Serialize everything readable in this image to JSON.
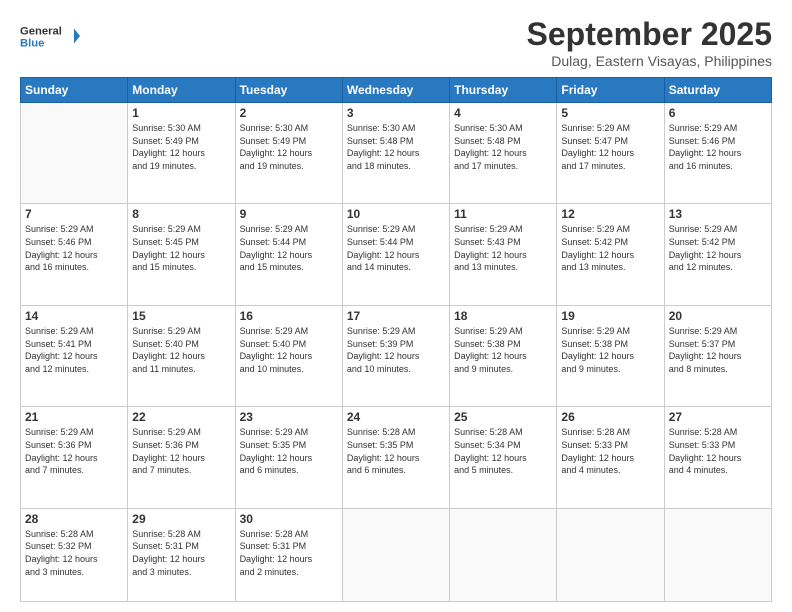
{
  "header": {
    "logo_line1": "General",
    "logo_line2": "Blue",
    "month": "September 2025",
    "location": "Dulag, Eastern Visayas, Philippines"
  },
  "weekdays": [
    "Sunday",
    "Monday",
    "Tuesday",
    "Wednesday",
    "Thursday",
    "Friday",
    "Saturday"
  ],
  "weeks": [
    [
      {
        "day": "",
        "info": ""
      },
      {
        "day": "1",
        "info": "Sunrise: 5:30 AM\nSunset: 5:49 PM\nDaylight: 12 hours\nand 19 minutes."
      },
      {
        "day": "2",
        "info": "Sunrise: 5:30 AM\nSunset: 5:49 PM\nDaylight: 12 hours\nand 19 minutes."
      },
      {
        "day": "3",
        "info": "Sunrise: 5:30 AM\nSunset: 5:48 PM\nDaylight: 12 hours\nand 18 minutes."
      },
      {
        "day": "4",
        "info": "Sunrise: 5:30 AM\nSunset: 5:48 PM\nDaylight: 12 hours\nand 17 minutes."
      },
      {
        "day": "5",
        "info": "Sunrise: 5:29 AM\nSunset: 5:47 PM\nDaylight: 12 hours\nand 17 minutes."
      },
      {
        "day": "6",
        "info": "Sunrise: 5:29 AM\nSunset: 5:46 PM\nDaylight: 12 hours\nand 16 minutes."
      }
    ],
    [
      {
        "day": "7",
        "info": "Sunrise: 5:29 AM\nSunset: 5:46 PM\nDaylight: 12 hours\nand 16 minutes."
      },
      {
        "day": "8",
        "info": "Sunrise: 5:29 AM\nSunset: 5:45 PM\nDaylight: 12 hours\nand 15 minutes."
      },
      {
        "day": "9",
        "info": "Sunrise: 5:29 AM\nSunset: 5:44 PM\nDaylight: 12 hours\nand 15 minutes."
      },
      {
        "day": "10",
        "info": "Sunrise: 5:29 AM\nSunset: 5:44 PM\nDaylight: 12 hours\nand 14 minutes."
      },
      {
        "day": "11",
        "info": "Sunrise: 5:29 AM\nSunset: 5:43 PM\nDaylight: 12 hours\nand 13 minutes."
      },
      {
        "day": "12",
        "info": "Sunrise: 5:29 AM\nSunset: 5:42 PM\nDaylight: 12 hours\nand 13 minutes."
      },
      {
        "day": "13",
        "info": "Sunrise: 5:29 AM\nSunset: 5:42 PM\nDaylight: 12 hours\nand 12 minutes."
      }
    ],
    [
      {
        "day": "14",
        "info": "Sunrise: 5:29 AM\nSunset: 5:41 PM\nDaylight: 12 hours\nand 12 minutes."
      },
      {
        "day": "15",
        "info": "Sunrise: 5:29 AM\nSunset: 5:40 PM\nDaylight: 12 hours\nand 11 minutes."
      },
      {
        "day": "16",
        "info": "Sunrise: 5:29 AM\nSunset: 5:40 PM\nDaylight: 12 hours\nand 10 minutes."
      },
      {
        "day": "17",
        "info": "Sunrise: 5:29 AM\nSunset: 5:39 PM\nDaylight: 12 hours\nand 10 minutes."
      },
      {
        "day": "18",
        "info": "Sunrise: 5:29 AM\nSunset: 5:38 PM\nDaylight: 12 hours\nand 9 minutes."
      },
      {
        "day": "19",
        "info": "Sunrise: 5:29 AM\nSunset: 5:38 PM\nDaylight: 12 hours\nand 9 minutes."
      },
      {
        "day": "20",
        "info": "Sunrise: 5:29 AM\nSunset: 5:37 PM\nDaylight: 12 hours\nand 8 minutes."
      }
    ],
    [
      {
        "day": "21",
        "info": "Sunrise: 5:29 AM\nSunset: 5:36 PM\nDaylight: 12 hours\nand 7 minutes."
      },
      {
        "day": "22",
        "info": "Sunrise: 5:29 AM\nSunset: 5:36 PM\nDaylight: 12 hours\nand 7 minutes."
      },
      {
        "day": "23",
        "info": "Sunrise: 5:29 AM\nSunset: 5:35 PM\nDaylight: 12 hours\nand 6 minutes."
      },
      {
        "day": "24",
        "info": "Sunrise: 5:28 AM\nSunset: 5:35 PM\nDaylight: 12 hours\nand 6 minutes."
      },
      {
        "day": "25",
        "info": "Sunrise: 5:28 AM\nSunset: 5:34 PM\nDaylight: 12 hours\nand 5 minutes."
      },
      {
        "day": "26",
        "info": "Sunrise: 5:28 AM\nSunset: 5:33 PM\nDaylight: 12 hours\nand 4 minutes."
      },
      {
        "day": "27",
        "info": "Sunrise: 5:28 AM\nSunset: 5:33 PM\nDaylight: 12 hours\nand 4 minutes."
      }
    ],
    [
      {
        "day": "28",
        "info": "Sunrise: 5:28 AM\nSunset: 5:32 PM\nDaylight: 12 hours\nand 3 minutes."
      },
      {
        "day": "29",
        "info": "Sunrise: 5:28 AM\nSunset: 5:31 PM\nDaylight: 12 hours\nand 3 minutes."
      },
      {
        "day": "30",
        "info": "Sunrise: 5:28 AM\nSunset: 5:31 PM\nDaylight: 12 hours\nand 2 minutes."
      },
      {
        "day": "",
        "info": ""
      },
      {
        "day": "",
        "info": ""
      },
      {
        "day": "",
        "info": ""
      },
      {
        "day": "",
        "info": ""
      }
    ]
  ]
}
